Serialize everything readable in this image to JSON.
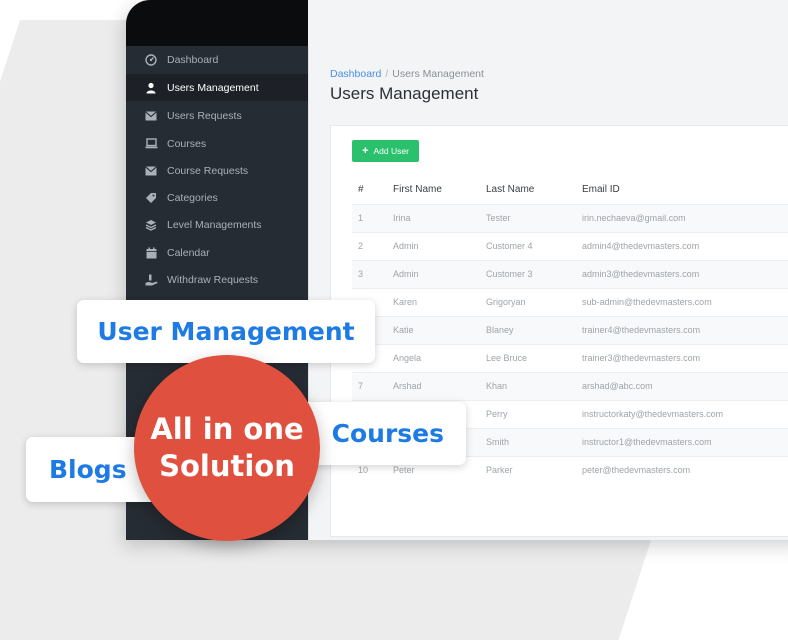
{
  "sidebar": {
    "items": [
      {
        "label": "Dashboard",
        "icon": "dashboard-icon"
      },
      {
        "label": "Users Management",
        "icon": "user-icon",
        "active": true
      },
      {
        "label": "Users Requests",
        "icon": "envelope-icon"
      },
      {
        "label": "Courses",
        "icon": "laptop-icon"
      },
      {
        "label": "Course Requests",
        "icon": "envelope-icon"
      },
      {
        "label": "Categories",
        "icon": "tag-icon"
      },
      {
        "label": "Level Managements",
        "icon": "layers-icon"
      },
      {
        "label": "Calendar",
        "icon": "calendar-icon"
      },
      {
        "label": "Withdraw Requests",
        "icon": "hand-money-icon"
      }
    ]
  },
  "breadcrumb": {
    "home": "Dashboard",
    "separator": "/",
    "current": "Users Management"
  },
  "page_title": "Users Management",
  "add_button": {
    "icon": "plus-icon",
    "label": "Add User"
  },
  "table": {
    "headers": [
      "#",
      "First Name",
      "Last Name",
      "Email ID"
    ],
    "rows": [
      {
        "num": "1",
        "first": "Irina",
        "last": "Tester",
        "email": "irin.nechaeva@gmail.com"
      },
      {
        "num": "2",
        "first": "Admin",
        "last": "Customer 4",
        "email": "admin4@thedevmasters.com"
      },
      {
        "num": "3",
        "first": "Admin",
        "last": "Customer 3",
        "email": "admin3@thedevmasters.com"
      },
      {
        "num": "",
        "first": "Karen",
        "last": "Grigoryan",
        "email": "sub-admin@thedevmasters.com"
      },
      {
        "num": "",
        "first": "Katie",
        "last": "Blaney",
        "email": "trainer4@thedevmasters.com"
      },
      {
        "num": "",
        "first": "Angela",
        "last": "Lee Bruce",
        "email": "trainer3@thedevmasters.com"
      },
      {
        "num": "7",
        "first": "Arshad",
        "last": "Khan",
        "email": "arshad@abc.com"
      },
      {
        "num": "",
        "first": "",
        "last": "Perry",
        "email": "instructorkaty@thedevmasters.com"
      },
      {
        "num": "",
        "first": "",
        "last": "Smith",
        "email": "instructor1@thedevmasters.com"
      },
      {
        "num": "10",
        "first": "Peter",
        "last": "Parker",
        "email": "peter@thedevmasters.com"
      }
    ]
  },
  "overlays": {
    "user_management": "User Management",
    "courses": "Courses",
    "blogs": "Blogs",
    "circle_line1": "All in one",
    "circle_line2": "Solution"
  },
  "colors": {
    "sidebar_bg": "#262c33",
    "accent_blue": "#1e7be3",
    "add_button": "#2bc16c",
    "circle": "#e0503e"
  }
}
